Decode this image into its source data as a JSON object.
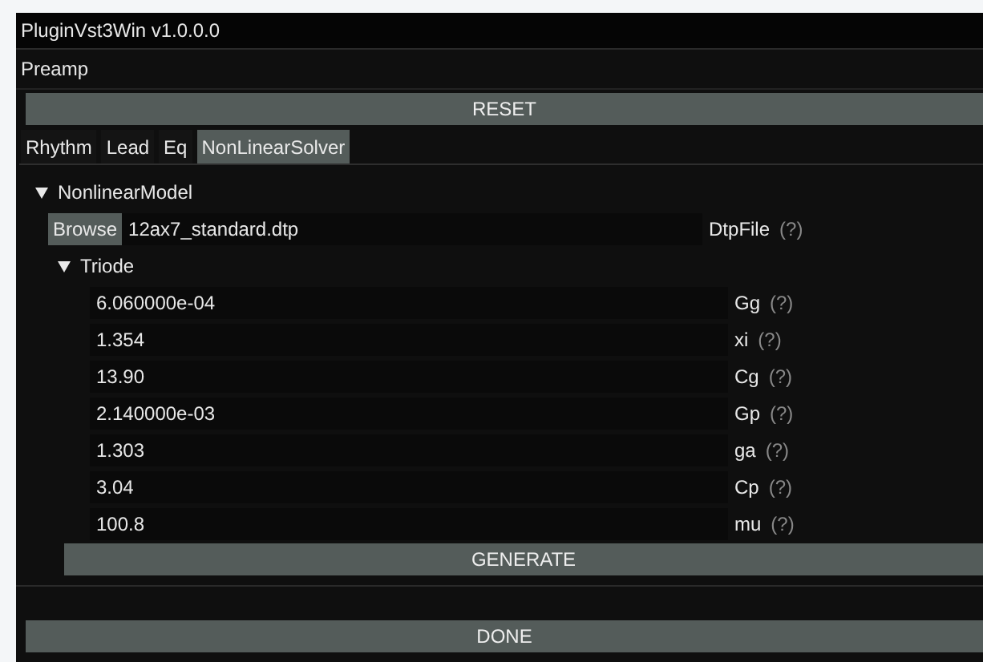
{
  "window": {
    "title": "PluginVst3Win v1.0.0.0"
  },
  "section": {
    "title": "Preamp"
  },
  "reset_button": "RESET",
  "tabs": [
    {
      "label": "Rhythm",
      "selected": false
    },
    {
      "label": "Lead",
      "selected": false
    },
    {
      "label": "Eq",
      "selected": false
    },
    {
      "label": "NonLinearSolver",
      "selected": true
    }
  ],
  "model": {
    "label": "NonlinearModel",
    "expanded": true,
    "file": {
      "button": "Browse",
      "value": "12ax7_standard.dtp",
      "label": "DtpFile",
      "help": "(?)"
    },
    "triode": {
      "label": "Triode",
      "expanded": true,
      "params": [
        {
          "value": "6.060000e-04",
          "label": "Gg",
          "help": "(?)"
        },
        {
          "value": "1.354",
          "label": "xi",
          "help": "(?)"
        },
        {
          "value": "13.90",
          "label": "Cg",
          "help": "(?)"
        },
        {
          "value": "2.140000e-03",
          "label": "Gp",
          "help": "(?)"
        },
        {
          "value": "1.303",
          "label": "ga",
          "help": "(?)"
        },
        {
          "value": "3.04",
          "label": "Cp",
          "help": "(?)"
        },
        {
          "value": "100.8",
          "label": "mu",
          "help": "(?)"
        }
      ]
    },
    "generate_button": "GENERATE"
  },
  "done_button": "DONE"
}
